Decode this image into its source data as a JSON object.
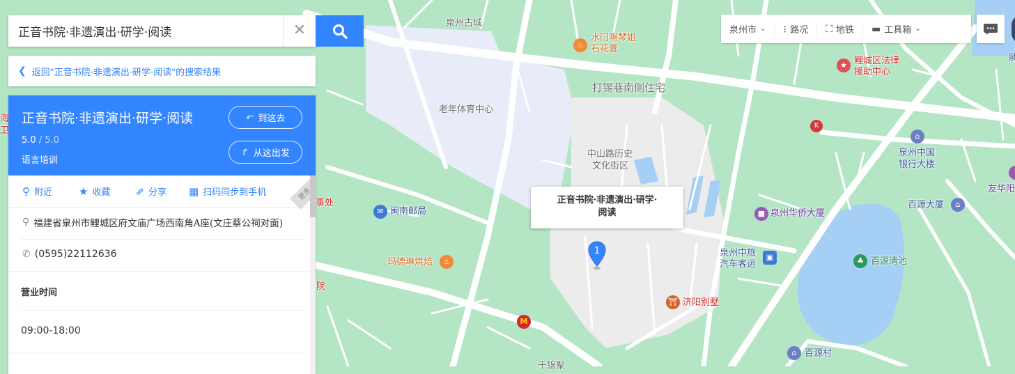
{
  "search": {
    "value": "正音书院·非遗演出·研学·阅读",
    "placeholder": "",
    "clear_icon": "close-icon",
    "search_icon": "search-icon"
  },
  "back": {
    "label": "返回\"正音书院·非遗演出·研学·阅读\"的搜索结果"
  },
  "place": {
    "title": "正音书院·非遗演出·研学·阅读",
    "rating": "5.0",
    "rating_max": " / 5.0",
    "category": "语言培训",
    "go_here": "到这去",
    "from_here": "从这出发",
    "actions": [
      {
        "label": "附近",
        "icon": "location-pin-icon"
      },
      {
        "label": "收藏",
        "icon": "star-icon"
      },
      {
        "label": "分享",
        "icon": "share-icon"
      },
      {
        "label": "扫码同步到手机",
        "icon": "qr-code-icon"
      }
    ],
    "corner_tag": "更多",
    "address": "福建省泉州市鲤城区府文庙广场西南角A座(文庄蔡公祠对面)",
    "phone": "(0595)22112636",
    "hours_title": "营业时间",
    "hours": "09:00-18:00"
  },
  "callout": {
    "line1": "正音书院·非遗演出·研学·",
    "line2": "阅读",
    "marker": "1"
  },
  "toolbar": {
    "city": "泉州市",
    "traffic": "路况",
    "subway": "地铁",
    "tools": "工具箱"
  },
  "map_labels": {
    "quanzhou_gucheng": "泉州古城",
    "shuimen": "水门啊琴姐",
    "shihuagao": "石花膏",
    "dazi": "打锡巷南侧住宅",
    "laonian": "老年体育中心",
    "zhongshan1": "中山路历史",
    "zhongshan2": "文化街区",
    "legal1": "鲤城区法律",
    "legal2": "援助中心",
    "boc1": "泉州中国",
    "boc2": "银行大楼",
    "youhua": "友华阳",
    "minnan_post": "闽南邮局",
    "madelin": "玛德琳烘焙",
    "huaqiao": "泉州华侨大厦",
    "zhonglv1": "泉州中旅",
    "zhonglv2": "汽车客运",
    "baiyuan_tower": "百源大厦",
    "baiyuan_pool": "百源清池",
    "jiyang": "济阳别墅",
    "baiyuan_village": "百源村",
    "shichu": "事处",
    "hai": "海",
    "wei": "卫",
    "yuan": "院",
    "xi": "西",
    "qianjin": "千锦聚",
    "edge_q": "泉"
  },
  "colors": {
    "map_green": "#b4e5c5",
    "road": "#ffffff",
    "accent": "#3385ff",
    "water": "#a6cff5",
    "block": "#e8edf8"
  }
}
